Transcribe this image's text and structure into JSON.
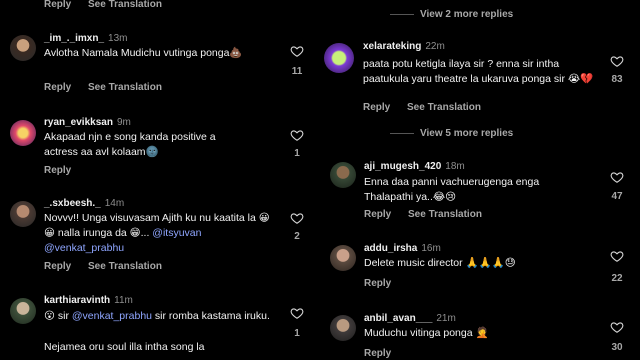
{
  "left": {
    "top_actions": {
      "reply": "Reply",
      "translate": "See Translation"
    },
    "comments": [
      {
        "username": "_im_._imxn_",
        "time": "13m",
        "text": "Avlotha Namala Mudichu vutinga ponga💩",
        "likes": "11",
        "reply": "Reply",
        "translate": "See Translation"
      },
      {
        "username": "ryan_evikksan",
        "time": "9m",
        "text": "Akapaad njn e song kanda positive a actress aa avl kolaam🌚",
        "likes": "1",
        "reply": "Reply"
      },
      {
        "username": "_.sxbeesh._",
        "time": "14m",
        "text_parts": [
          "Novvv!! Unga visuvasam Ajith ku nu kaatita la 😀😀 nalla irunga da 😁... ",
          "@itsyuvan",
          " ",
          "@venkat_prabhu"
        ],
        "likes": "2",
        "reply": "Reply",
        "translate": "See Translation"
      },
      {
        "username": "karthiaravinth",
        "time": "11m",
        "text_parts": [
          "😮 sir ",
          "@venkat_prabhu",
          " sir romba kastama iruku."
        ],
        "text2": "Nejamea oru soul illa intha song la",
        "likes": "1"
      }
    ]
  },
  "right": {
    "view_more_top": "View 2 more replies",
    "view_more_mid": "View 5 more replies",
    "comments": [
      {
        "username": "xelarateking",
        "time": "22m",
        "text": "paata potu ketigla ilaya sir ? enna sir intha paatukula yaru theatre la ukaruva ponga sir 😭💔",
        "likes": "83",
        "reply": "Reply",
        "translate": "See Translation"
      },
      {
        "username": "aji_mugesh_420",
        "time": "18m",
        "text": "Enna daa panni vachuerugenga enga Thalapathi ya..😂😢",
        "likes": "47",
        "reply": "Reply",
        "translate": "See Translation"
      },
      {
        "username": "addu_irsha",
        "time": "16m",
        "text": "Delete music director 🙏🙏🙏😓",
        "likes": "22",
        "reply": "Reply"
      },
      {
        "username": "anbil_avan___",
        "time": "21m",
        "text": "Muduchu vitinga ponga 🤦",
        "likes": "30",
        "reply": "Reply"
      }
    ]
  },
  "colors": {
    "background": "#000000",
    "mention": "#8fa6ff",
    "secondary": "#a8a8a8"
  }
}
